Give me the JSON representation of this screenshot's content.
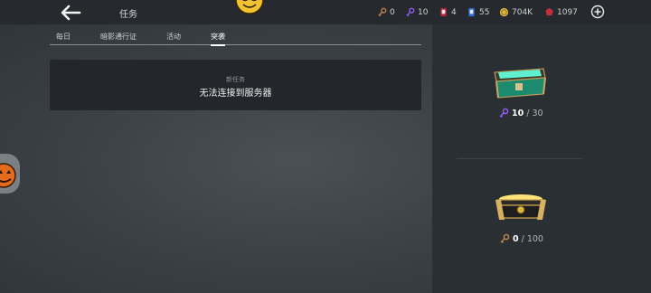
{
  "header": {
    "title": "任务",
    "resources": [
      {
        "icon": "bronze-key-icon",
        "value": "0"
      },
      {
        "icon": "purple-key-icon",
        "value": "10"
      },
      {
        "icon": "red-card-icon",
        "value": "4"
      },
      {
        "icon": "blue-card-icon",
        "value": "55"
      },
      {
        "icon": "gold-coin-icon",
        "value": "704K"
      },
      {
        "icon": "red-gem-icon",
        "value": "1097"
      }
    ]
  },
  "tabs": [
    {
      "label": "每日",
      "active": false
    },
    {
      "label": "暗影通行证",
      "active": false
    },
    {
      "label": "活动",
      "active": false
    },
    {
      "label": "突袭",
      "active": true
    }
  ],
  "panel": {
    "subtitle": "新任务",
    "message": "无法连接到服务器"
  },
  "rewards": [
    {
      "chest": "jade-chest-icon",
      "key": "purple-key-icon",
      "current": "10",
      "total": "/ 30"
    },
    {
      "chest": "gold-chest-icon",
      "key": "bronze-key-icon",
      "current": "0",
      "total": "/ 100"
    }
  ],
  "colors": {
    "purple_key": "#9b5cff",
    "bronze_key": "#c8884a",
    "gold": "#e0b640",
    "jade": "#2fc9a0"
  }
}
